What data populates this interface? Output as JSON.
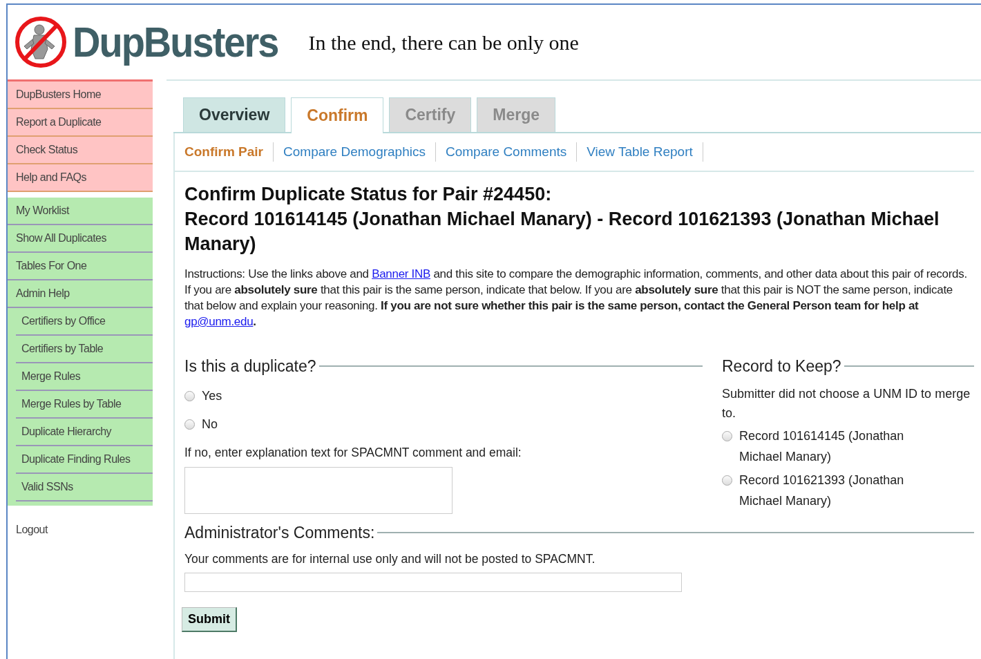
{
  "header": {
    "logo_text": "DupBusters",
    "tagline": "In the end, there can be only one"
  },
  "sidebar": {
    "groups": [
      {
        "kind": "public",
        "items": [
          {
            "label": "DupBusters Home"
          },
          {
            "label": "Report a Duplicate"
          },
          {
            "label": "Check Status"
          },
          {
            "label": "Help and FAQs"
          }
        ]
      },
      {
        "kind": "admin",
        "items": [
          {
            "label": "My Worklist"
          },
          {
            "label": "Show All Duplicates"
          },
          {
            "label": "Tables For One"
          },
          {
            "label": "Admin Help",
            "children": [
              {
                "label": "Certifiers by Office"
              },
              {
                "label": "Certifiers by Table"
              },
              {
                "label": "Merge Rules"
              },
              {
                "label": "Merge Rules by Table"
              },
              {
                "label": "Duplicate Hierarchy"
              },
              {
                "label": "Duplicate Finding Rules"
              },
              {
                "label": "Valid SSNs"
              }
            ]
          }
        ]
      },
      {
        "kind": "plain",
        "items": [
          {
            "label": "Logout"
          }
        ]
      }
    ]
  },
  "tabs": [
    {
      "label": "Overview",
      "selected": false,
      "disabled": false
    },
    {
      "label": "Confirm",
      "selected": true,
      "disabled": false
    },
    {
      "label": "Certify",
      "selected": false,
      "disabled": true
    },
    {
      "label": "Merge",
      "selected": false,
      "disabled": true
    }
  ],
  "subtabs": [
    {
      "label": "Confirm Pair",
      "selected": true
    },
    {
      "label": "Compare Demographics",
      "selected": false
    },
    {
      "label": "Compare Comments",
      "selected": false
    },
    {
      "label": "View Table Report",
      "selected": false
    }
  ],
  "heading": [
    "Confirm Duplicate Status for Pair #24450:",
    "Record 101614145 (Jonathan Michael Manary) - Record 101621393 (Jonathan Michael Manary)"
  ],
  "instructions": [
    {
      "kind": "text",
      "text": "Instructions: Use the links above and "
    },
    {
      "kind": "link",
      "text": "Banner INB"
    },
    {
      "kind": "text",
      "text": " and this site to compare the demographic information, comments, and other data about this pair of records. If you are **absolutely sure** that this pair is the same person, indicate that below. If you are **absolutely sure** that this pair is NOT the same person, indicate that below and explain your reasoning. **If you are not sure whether this pair is the same person, contact the General Person team for help at** "
    },
    {
      "kind": "link",
      "text": "gp@unm.edu"
    },
    {
      "kind": "text",
      "text": "**.**"
    }
  ],
  "duplicate_question": {
    "legend": "Is this a duplicate?",
    "options": [
      {
        "label": "Yes",
        "selected": false
      },
      {
        "label": "No",
        "selected": false
      }
    ],
    "explanation_label": "If no, enter explanation text for SPACMNT comment and email:"
  },
  "record_to_keep": {
    "legend": "Record to Keep?",
    "note": "Submitter did not choose a UNM ID to merge to.",
    "options": [
      {
        "label": "Record 101614145 (Jonathan Michael Manary)",
        "selected": false
      },
      {
        "label": "Record 101621393 (Jonathan Michael Manary)",
        "selected": false
      }
    ]
  },
  "admin_comments": {
    "legend": "Administrator's Comments:",
    "note": "Your comments are for internal use only and will not be posted to SPACMNT."
  },
  "submit_button": "Submit"
}
